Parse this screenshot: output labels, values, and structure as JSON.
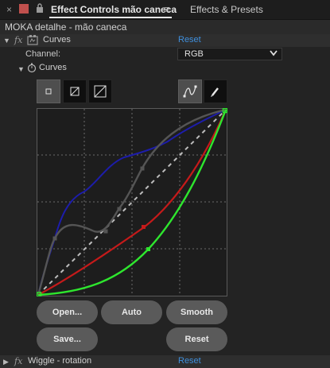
{
  "tabs": {
    "close_glyph": "×",
    "active_label": "Effect Controls mão caneca",
    "menu_glyph": "≡",
    "other_label": "Effects & Presets"
  },
  "layer": {
    "title": "MOKA detalhe - mão caneca"
  },
  "effects": {
    "curves": {
      "name": "Curves",
      "reset_label": "Reset"
    },
    "channel": {
      "label": "Channel:",
      "value": "RGB"
    },
    "curves_sub": {
      "name": "Curves"
    },
    "wiggle": {
      "name": "Wiggle - rotation",
      "reset_label": "Reset"
    }
  },
  "curve_buttons": {
    "open": "Open...",
    "auto": "Auto",
    "smooth": "Smooth",
    "save": "Save...",
    "reset": "Reset"
  },
  "colors": {
    "accent": "#3f8fdc",
    "rgb_curve": "#5a5a5a",
    "red_curve": "#c51a1a",
    "green_curve": "#2ee62e",
    "blue_curve": "#1d1daa"
  }
}
